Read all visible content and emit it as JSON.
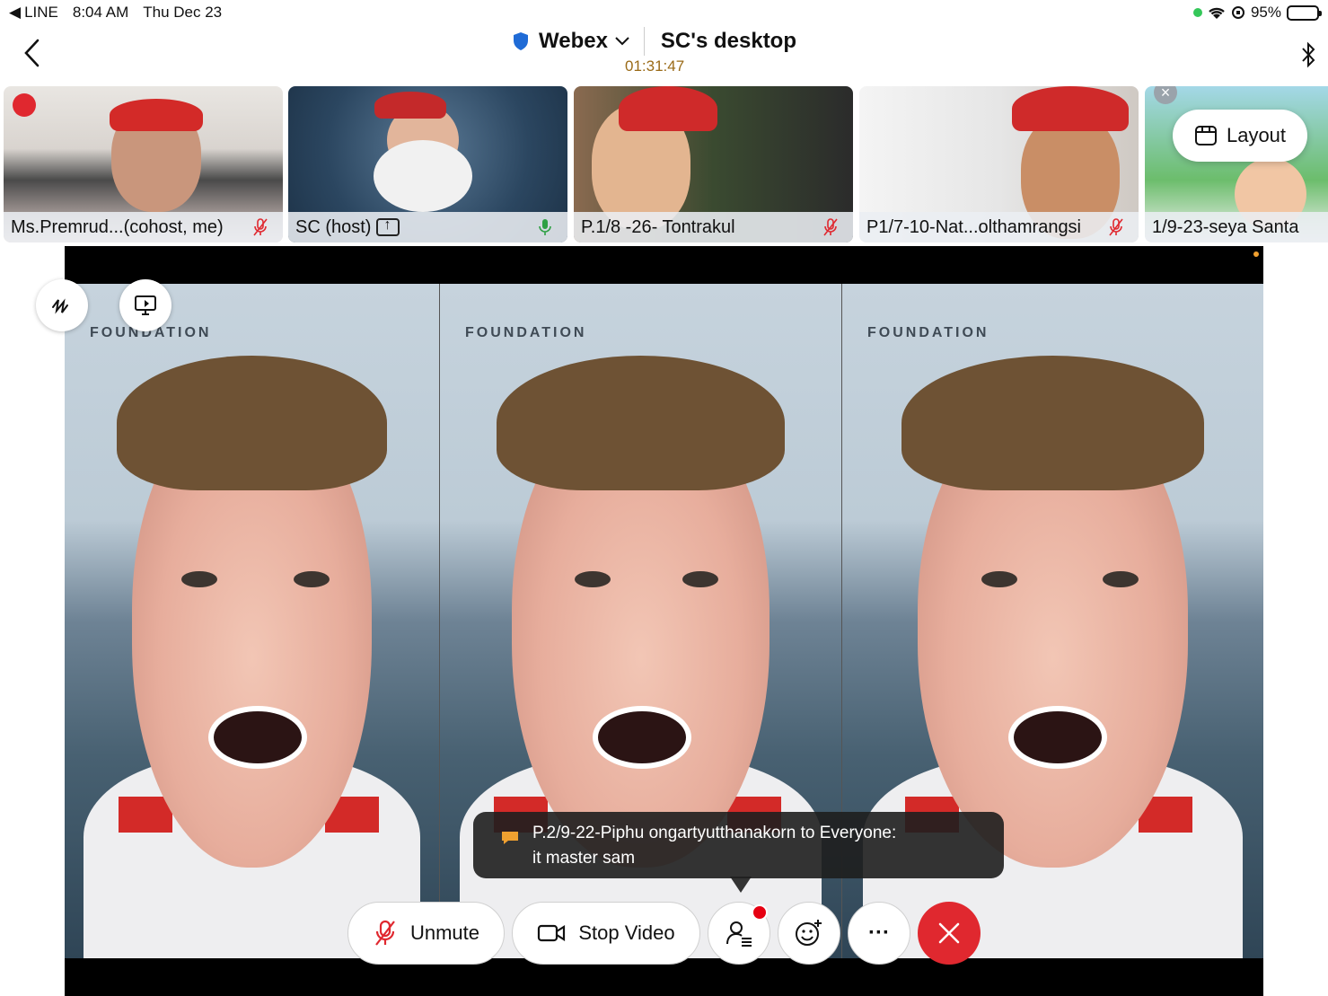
{
  "status_bar": {
    "back_app": "LINE",
    "time": "8:04 AM",
    "date": "Thu Dec 23",
    "battery": "95%",
    "battery_level": 0.95
  },
  "header": {
    "app_name": "Webex",
    "share_title": "SC's desktop",
    "timer": "01:31:47"
  },
  "participants": [
    {
      "label": "Ms.Premrud...(cohost, me)",
      "muted": true
    },
    {
      "label": "SC (host)",
      "muted": false,
      "sharing": true
    },
    {
      "label": "P.1/8 -26- Tontrakul",
      "muted": true
    },
    {
      "label": "P1/7-10-Nat...olthamrangsi",
      "muted": true
    },
    {
      "label": "1/9-23-seya Santa",
      "muted": false
    }
  ],
  "layout_button": "Layout",
  "share_content": {
    "logo_text": "FOUNDATION"
  },
  "chat_toast": {
    "sender_line": "P.2/9-22-Piphu ongartyutthanakorn to Everyone:",
    "message": "it master sam"
  },
  "controls": {
    "unmute": "Unmute",
    "stop_video": "Stop Video",
    "more": "···"
  },
  "colors": {
    "accent_red": "#e0282f",
    "timer": "#9a6a17",
    "unmute_icon": "#e0282f"
  }
}
